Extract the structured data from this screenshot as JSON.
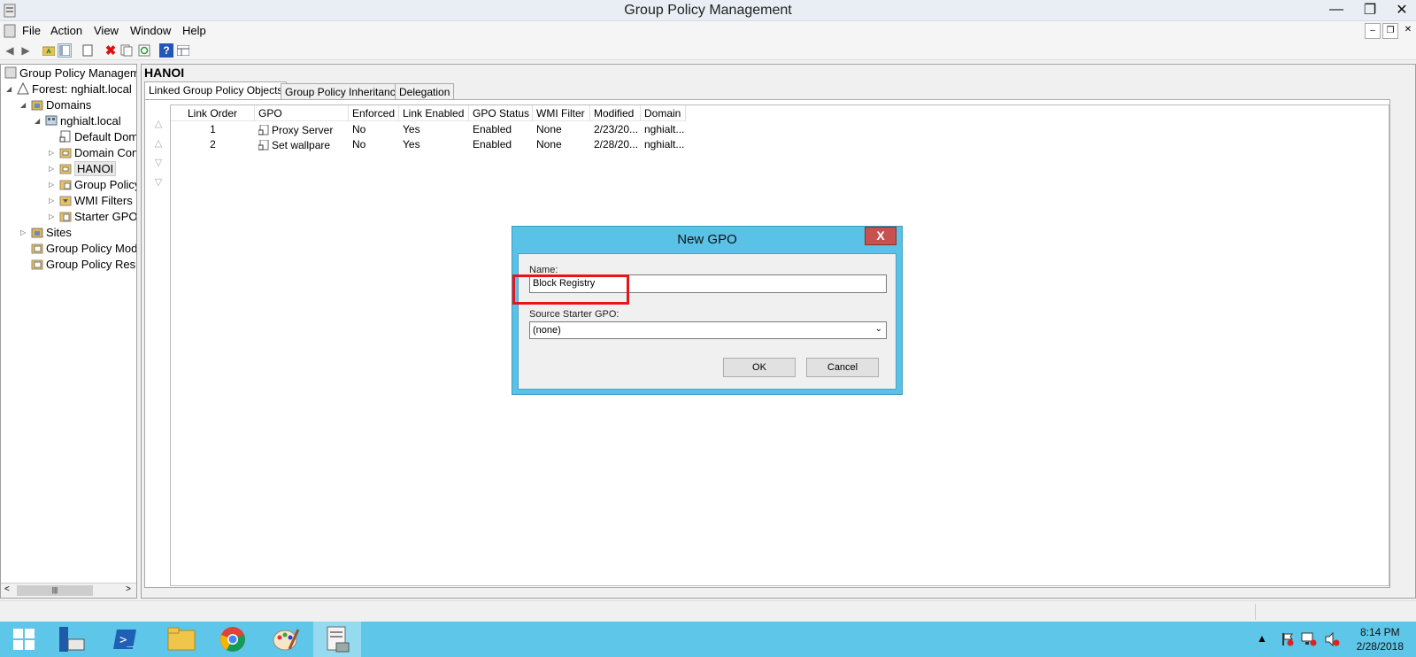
{
  "window": {
    "title": "Group Policy Management"
  },
  "menu": [
    "File",
    "Action",
    "View",
    "Window",
    "Help"
  ],
  "tree": {
    "root": "Group Policy Manageme",
    "forest": "Forest: nghialt.local",
    "domains": "Domains",
    "domain": "nghialt.local",
    "default_policy": "Default Dom",
    "domain_controllers": "Domain Con",
    "hanoi": "HANOI",
    "group_policy_objects": "Group Policy",
    "wmi_filters": "WMI Filters",
    "starter_gpos": "Starter GPOs",
    "sites": "Sites",
    "modeling": "Group Policy Mode",
    "results": "Group Policy Resul"
  },
  "ou": {
    "title": "HANOI"
  },
  "tabs": [
    "Linked Group Policy Objects",
    "Group Policy Inheritance",
    "Delegation"
  ],
  "grid": {
    "headers": [
      "Link Order",
      "GPO",
      "Enforced",
      "Link Enabled",
      "GPO Status",
      "WMI Filter",
      "Modified",
      "Domain"
    ],
    "rows": [
      [
        "1",
        "Proxy Server",
        "No",
        "Yes",
        "Enabled",
        "None",
        "2/23/20...",
        "nghialt..."
      ],
      [
        "2",
        "Set wallpare",
        "No",
        "Yes",
        "Enabled",
        "None",
        "2/28/20...",
        "nghialt..."
      ]
    ]
  },
  "dialog": {
    "title": "New GPO",
    "close": "X",
    "name_label": "Name:",
    "name_value": "Block Registry",
    "source_label": "Source Starter GPO:",
    "source_value": "(none)",
    "ok": "OK",
    "cancel": "Cancel"
  },
  "taskbar": {
    "time": "8:14 PM",
    "date": "2/28/2018"
  },
  "colors": {
    "dialog_frame": "#5ac2e6",
    "taskbar": "#5ec6e8",
    "highlight_box": "#e8141c",
    "close_button": "#c75050"
  }
}
